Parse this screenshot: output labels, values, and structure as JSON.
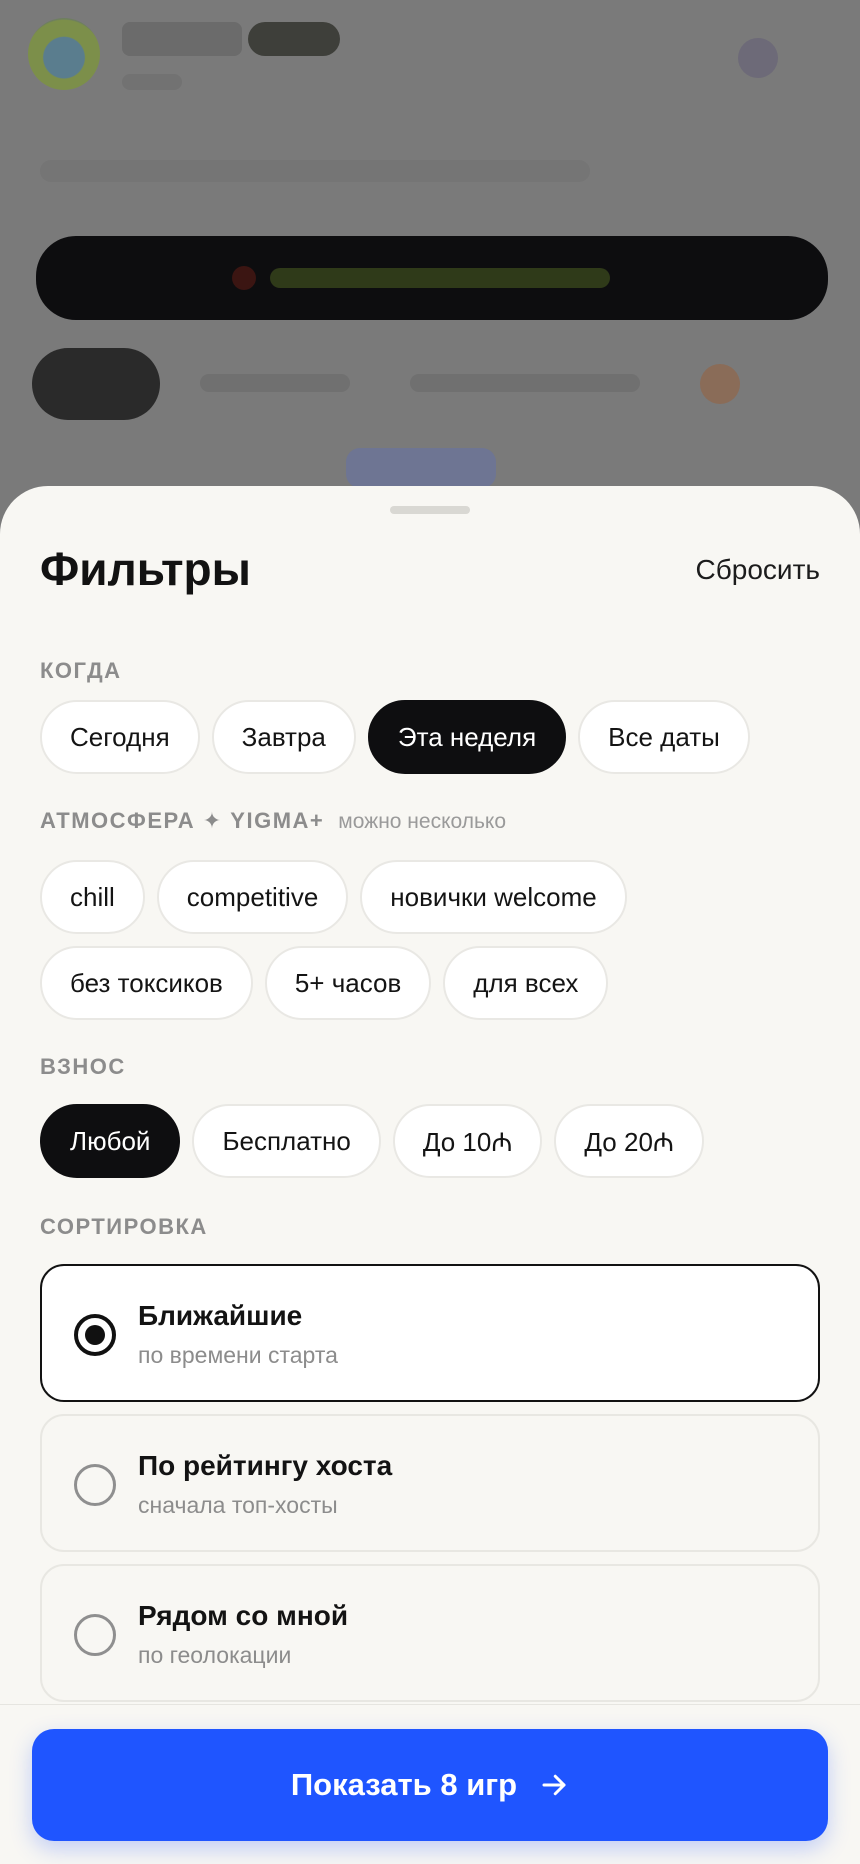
{
  "sheet": {
    "title": "Фильтры",
    "reset_label": "Сбросить"
  },
  "when": {
    "label": "КОГДА",
    "options": [
      "Сегодня",
      "Завтра",
      "Эта неделя",
      "Все даты"
    ],
    "selected": "Эта неделя"
  },
  "atmosphere": {
    "label": "АТМОСФЕРА ✦ YIGMA+",
    "hint": "можно несколько",
    "options": [
      "chill",
      "competitive",
      "новички welcome",
      "без токсиков",
      "5+ часов",
      "для всех"
    ]
  },
  "fee": {
    "label": "ВЗНОС",
    "options": [
      "Любой",
      "Бесплатно",
      "До 10₼",
      "До 20₼"
    ],
    "selected": "Любой"
  },
  "sort": {
    "label": "СОРТИРОВКА",
    "options": [
      {
        "title": "Ближайшие",
        "subtitle": "по времени старта"
      },
      {
        "title": "По рейтингу хоста",
        "subtitle": "сначала топ-хосты"
      },
      {
        "title": "Рядом со мной",
        "subtitle": "по геолокации"
      }
    ],
    "selected": "Ближайшие"
  },
  "cta": {
    "label": "Показать 8 игр",
    "icon": "arrow-right-icon"
  },
  "colors": {
    "accent": "#1f55ff",
    "chip_active": "#0e0e10",
    "sheet_bg": "#f8f7f3"
  }
}
